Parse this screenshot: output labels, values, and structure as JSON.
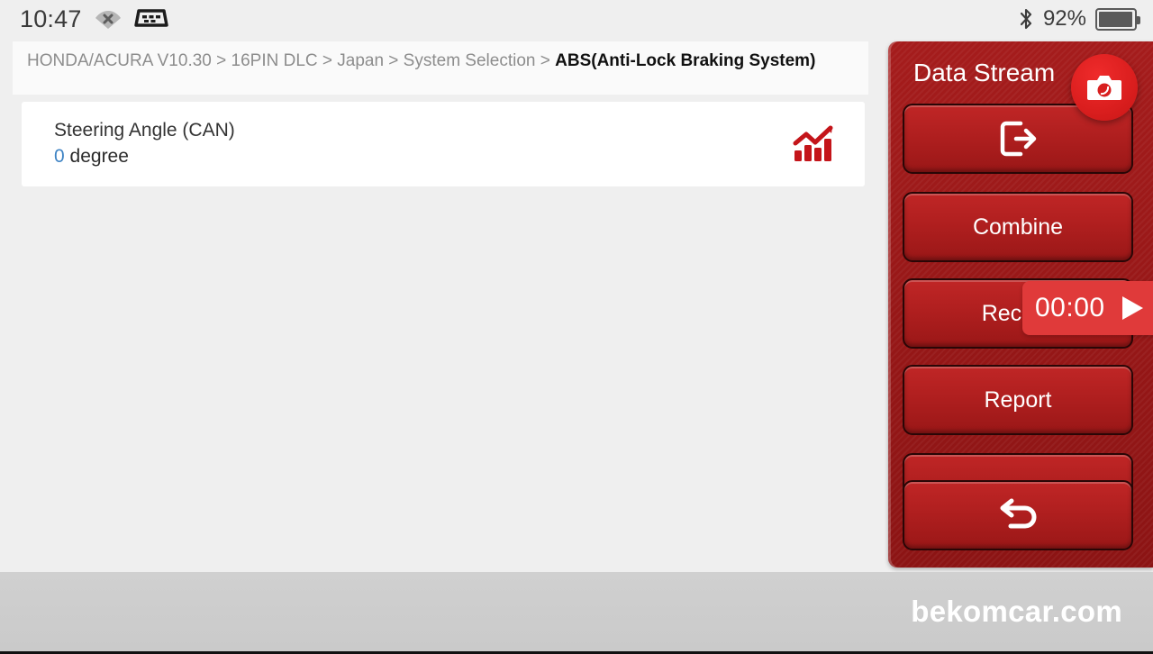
{
  "statusbar": {
    "time": "10:47",
    "wifi_icon": "wifi-off-icon",
    "connector_icon": "obd-connector-icon",
    "bluetooth_icon": "bluetooth-icon",
    "battery_percent": "92%",
    "battery_icon": "battery-icon"
  },
  "breadcrumb": {
    "prefix": "HONDA/ACURA V10.30 > 16PIN DLC > Japan > System Selection > ",
    "current": "ABS(Anti-Lock Braking System)"
  },
  "datastream": {
    "items": [
      {
        "name": "Steering Angle (CAN)",
        "value": "0",
        "unit": "degree",
        "graph_icon": "bar-chart-icon"
      }
    ]
  },
  "panel": {
    "title": "Data Stream",
    "camera_button": "camera-icon",
    "buttons": [
      {
        "label": "",
        "icon": "exit-icon"
      },
      {
        "label": "Combine",
        "icon": ""
      },
      {
        "label": "Record",
        "icon": ""
      },
      {
        "label": "Report",
        "icon": ""
      },
      {
        "label": "",
        "icon": ""
      },
      {
        "label": "",
        "icon": "back-arrow-icon"
      }
    ]
  },
  "recorder": {
    "elapsed": "00:00",
    "play_icon": "play-icon"
  },
  "footer": {
    "watermark": "bekomcar.com"
  },
  "colors": {
    "panel_red": "#9a1717",
    "button_red": "#b01f1f",
    "accent_red": "#c81616",
    "timer_red": "#e03a3a",
    "value_blue": "#3f84c4",
    "background": "#efefef",
    "footer_gray": "#cccccc"
  }
}
